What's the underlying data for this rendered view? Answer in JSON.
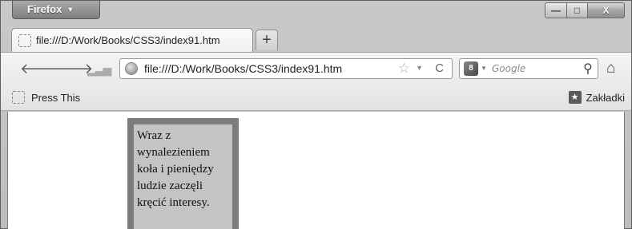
{
  "window": {
    "app_button_label": "Firefox",
    "controls": {
      "minimize": "—",
      "maximize": "□",
      "close": "X"
    }
  },
  "tabs": [
    {
      "title": "file:///D:/Work/Books/CSS3/index91.htm"
    }
  ],
  "new_tab_label": "+",
  "navbar": {
    "url": "file:///D:/Work/Books/CSS3/index91.htm",
    "search_engine_label": "8",
    "search_placeholder": "Google"
  },
  "bookmarks": {
    "left_item": "Press This",
    "right_item": "Zakładki"
  },
  "page": {
    "paragraph": "Wraz z wynalezieniem koła i pieniędzy ludzie zaczęli kręcić interesy."
  }
}
